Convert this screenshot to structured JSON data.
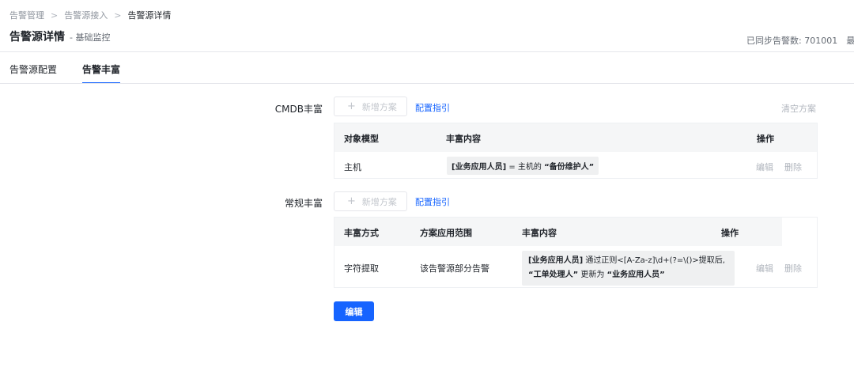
{
  "breadcrumb": {
    "items": [
      "告警管理",
      "告警源接入",
      "告警源详情"
    ],
    "separator": ">"
  },
  "header": {
    "title": "告警源详情",
    "subtitle": "- 基础监控",
    "sync_info": "已同步告警数: 701001　最"
  },
  "tabs": [
    {
      "label": "告警源配置",
      "active": false
    },
    {
      "label": "告警丰富",
      "active": true
    }
  ],
  "cmdb": {
    "label": "CMDB丰富",
    "add_button": "新增方案",
    "guide_link": "配置指引",
    "clear_link": "清空方案",
    "columns": [
      "对象模型",
      "丰富内容",
      "操作"
    ],
    "rows": [
      {
        "model": "主机",
        "content_role": "[业务应用人员]",
        "content_text": " = 主机的 ",
        "content_field": "“备份维护人”",
        "edit": "编辑",
        "delete": "删除"
      }
    ]
  },
  "regular": {
    "label": "常规丰富",
    "add_button": "新增方案",
    "guide_link": "配置指引",
    "columns": [
      "丰富方式",
      "方案应用范围",
      "丰富内容",
      "操作"
    ],
    "rows": [
      {
        "method": "字符提取",
        "scope": "该告警源部分告警",
        "content_role": "[业务应用人员]",
        "content_line1": " 通过正则<[A-Za-z]\\d+(?=\\()>提取后,",
        "content_src": "“工单处理人”",
        "content_mid": " 更新为 ",
        "content_dst": "“业务应用人员”",
        "edit": "编辑",
        "delete": "删除"
      }
    ]
  },
  "footer": {
    "edit_button": "编辑"
  },
  "colors": {
    "accent": "#1664ff",
    "muted": "#b0b5bd",
    "header_bg": "#f5f6f7"
  }
}
